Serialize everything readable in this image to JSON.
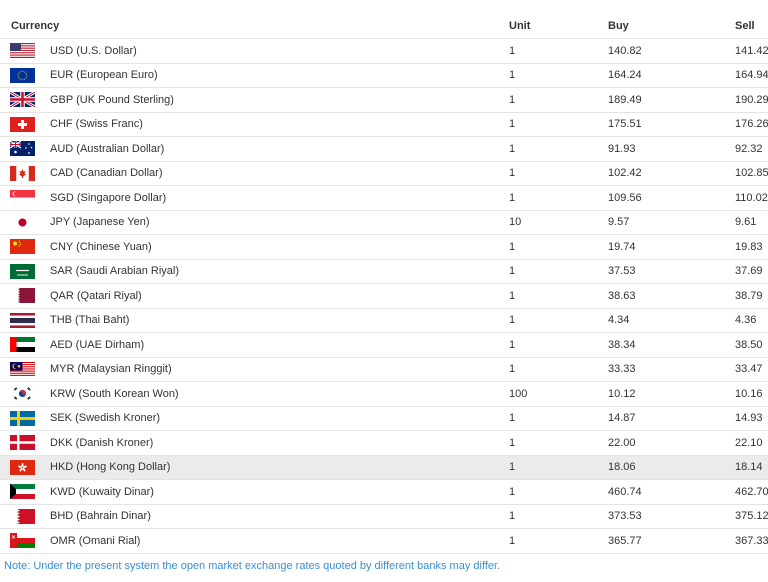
{
  "table": {
    "headers": {
      "currency": "Currency",
      "unit": "Unit",
      "buy": "Buy",
      "sell": "Sell"
    },
    "rows": [
      {
        "flag": "usa-flag-icon",
        "currency": "USD (U.S. Dollar)",
        "unit": "1",
        "buy": "140.82",
        "sell": "141.42"
      },
      {
        "flag": "eu-flag-icon",
        "currency": "EUR (European Euro)",
        "unit": "1",
        "buy": "164.24",
        "sell": "164.94"
      },
      {
        "flag": "uk-flag-icon",
        "currency": "GBP (UK Pound Sterling)",
        "unit": "1",
        "buy": "189.49",
        "sell": "190.29"
      },
      {
        "flag": "switzerland-flag-icon",
        "currency": "CHF (Swiss Franc)",
        "unit": "1",
        "buy": "175.51",
        "sell": "176.26"
      },
      {
        "flag": "australia-flag-icon",
        "currency": "AUD (Australian Dollar)",
        "unit": "1",
        "buy": "91.93",
        "sell": "92.32"
      },
      {
        "flag": "canada-flag-icon",
        "currency": "CAD (Canadian Dollar)",
        "unit": "1",
        "buy": "102.42",
        "sell": "102.85"
      },
      {
        "flag": "singapore-flag-icon",
        "currency": "SGD (Singapore Dollar)",
        "unit": "1",
        "buy": "109.56",
        "sell": "110.02"
      },
      {
        "flag": "japan-flag-icon",
        "currency": "JPY (Japanese Yen)",
        "unit": "10",
        "buy": "9.57",
        "sell": "9.61"
      },
      {
        "flag": "china-flag-icon",
        "currency": "CNY (Chinese Yuan)",
        "unit": "1",
        "buy": "19.74",
        "sell": "19.83"
      },
      {
        "flag": "saudi-arabia-flag-icon",
        "currency": "SAR (Saudi Arabian Riyal)",
        "unit": "1",
        "buy": "37.53",
        "sell": "37.69"
      },
      {
        "flag": "qatar-flag-icon",
        "currency": "QAR (Qatari Riyal)",
        "unit": "1",
        "buy": "38.63",
        "sell": "38.79"
      },
      {
        "flag": "thailand-flag-icon",
        "currency": "THB (Thai Baht)",
        "unit": "1",
        "buy": "4.34",
        "sell": "4.36"
      },
      {
        "flag": "uae-flag-icon",
        "currency": "AED (UAE Dirham)",
        "unit": "1",
        "buy": "38.34",
        "sell": "38.50"
      },
      {
        "flag": "malaysia-flag-icon",
        "currency": "MYR (Malaysian Ringgit)",
        "unit": "1",
        "buy": "33.33",
        "sell": "33.47"
      },
      {
        "flag": "south-korea-flag-icon",
        "currency": "KRW (South Korean Won)",
        "unit": "100",
        "buy": "10.12",
        "sell": "10.16"
      },
      {
        "flag": "sweden-flag-icon",
        "currency": "SEK (Swedish Kroner)",
        "unit": "1",
        "buy": "14.87",
        "sell": "14.93"
      },
      {
        "flag": "denmark-flag-icon",
        "currency": "DKK (Danish Kroner)",
        "unit": "1",
        "buy": "22.00",
        "sell": "22.10"
      },
      {
        "flag": "hong-kong-flag-icon",
        "currency": "HKD (Hong Kong Dollar)",
        "unit": "1",
        "buy": "18.06",
        "sell": "18.14",
        "highlighted": true
      },
      {
        "flag": "kuwait-flag-icon",
        "currency": "KWD (Kuwaity Dinar)",
        "unit": "1",
        "buy": "460.74",
        "sell": "462.70"
      },
      {
        "flag": "bahrain-flag-icon",
        "currency": "BHD (Bahrain Dinar)",
        "unit": "1",
        "buy": "373.53",
        "sell": "375.12"
      },
      {
        "flag": "oman-flag-icon",
        "currency": "OMR (Omani Rial)",
        "unit": "1",
        "buy": "365.77",
        "sell": "367.33"
      }
    ]
  },
  "note": "Note: Under the present system the open market exchange rates quoted by different banks may differ.",
  "colors": {
    "note_text": "#3b8fd0",
    "row_highlight": "#ebebeb",
    "row_divider": "#e4e4e4"
  }
}
